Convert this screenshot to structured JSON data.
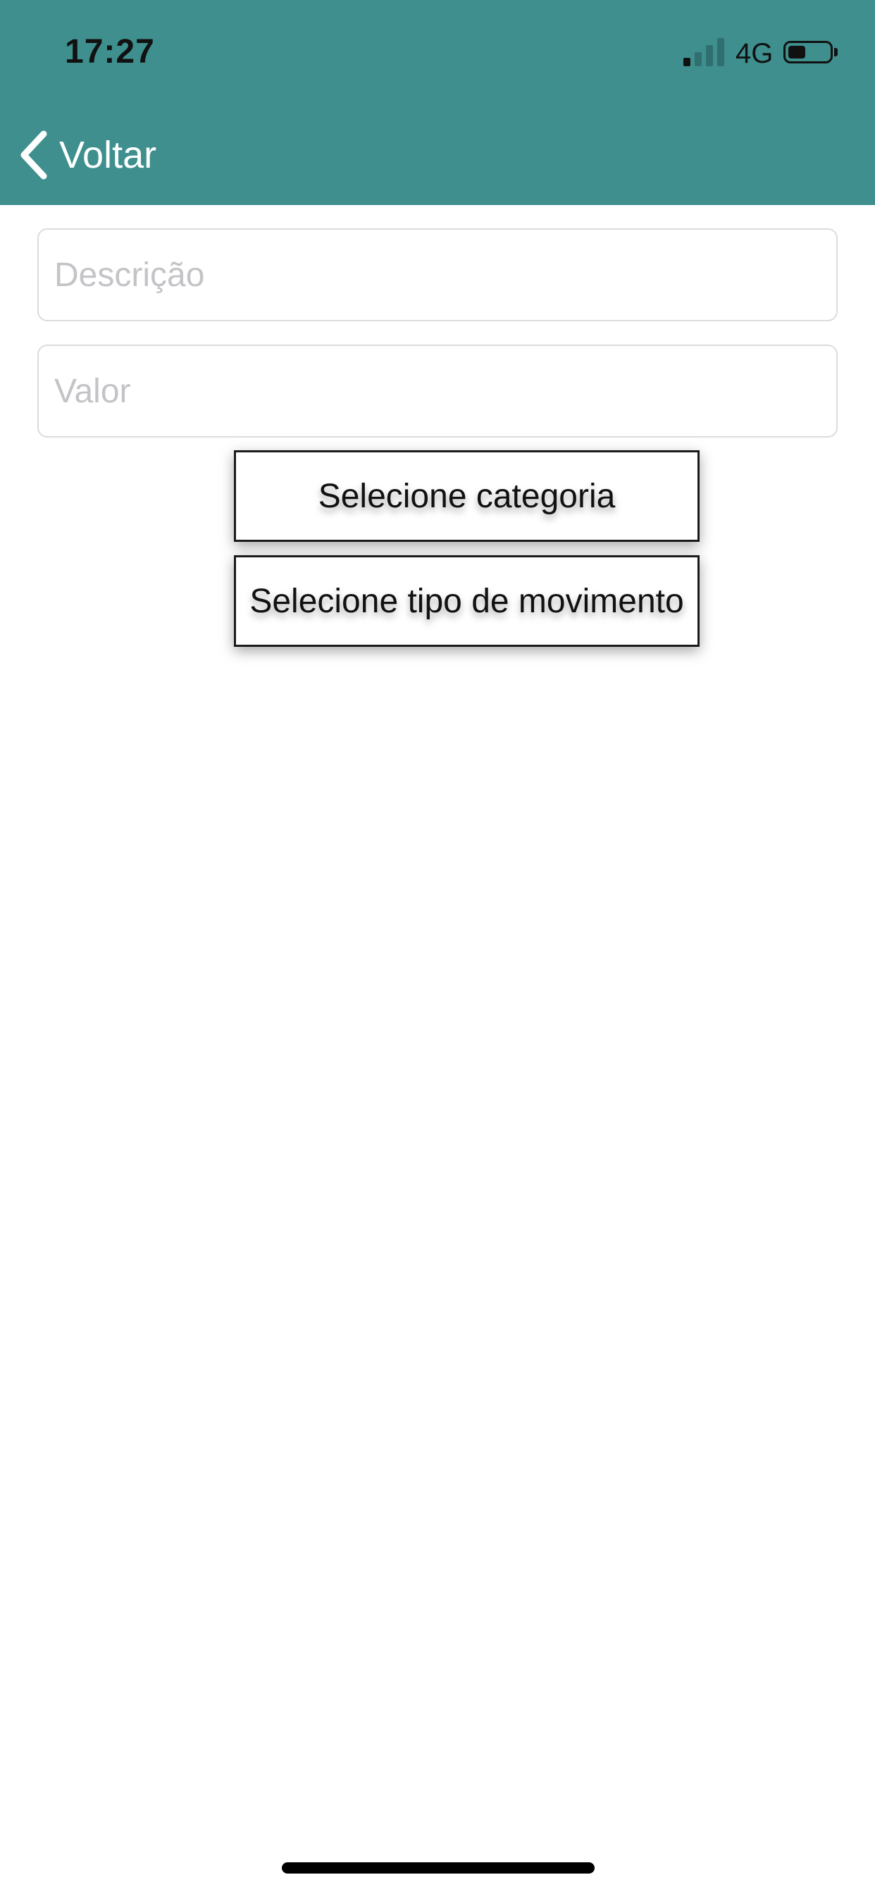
{
  "colors": {
    "header_bg": "#3f8f8f",
    "signal_active": "#111111",
    "signal_inactive": "#2f6f6f"
  },
  "status_bar": {
    "time": "17:27",
    "network": "4G",
    "signal_icon": "cellular-signal-icon",
    "battery_icon": "battery-icon"
  },
  "nav": {
    "back_label": "Voltar",
    "back_icon": "chevron-left-icon"
  },
  "form": {
    "description": {
      "placeholder": "Descrição",
      "value": ""
    },
    "value": {
      "placeholder": "Valor",
      "value": ""
    },
    "category_button_label": "Selecione categoria",
    "movement_type_button_label": "Selecione tipo de movimento"
  }
}
